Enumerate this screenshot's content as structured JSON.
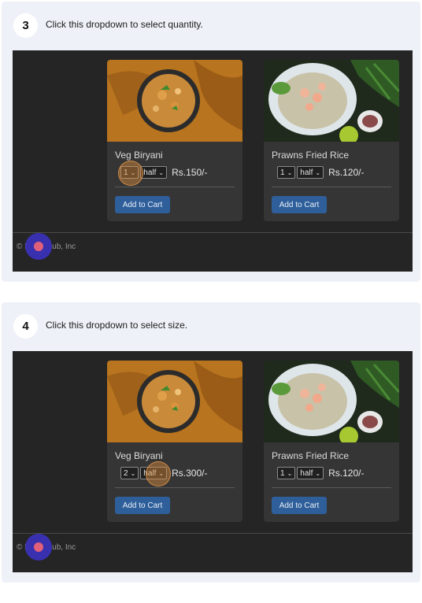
{
  "steps": [
    {
      "number": "3",
      "instruction": "Click this dropdown to select quantity.",
      "cards": [
        {
          "title": "Veg Biryani",
          "qty": "1",
          "size": "half",
          "price": "Rs.150/-",
          "button": "Add to Cart"
        },
        {
          "title": "Prawns Fried Rice",
          "qty": "1",
          "size": "half",
          "price": "Rs.120/-",
          "button": "Add to Cart"
        }
      ],
      "footer": "© FoodyHub, Inc"
    },
    {
      "number": "4",
      "instruction": "Click this dropdown to select size.",
      "cards": [
        {
          "title": "Veg Biryani",
          "qty": "2",
          "size": "half",
          "price": "Rs.300/-",
          "button": "Add to Cart"
        },
        {
          "title": "Prawns Fried Rice",
          "qty": "1",
          "size": "half",
          "price": "Rs.120/-",
          "button": "Add to Cart"
        }
      ],
      "footer": "© FoodyHub, Inc"
    }
  ],
  "colors": {
    "app_bg": "#252525",
    "card_bg": "#353535",
    "button": "#2f5f9a",
    "cursor": "#3930b0",
    "highlight": "#de8c3c"
  },
  "icons": {
    "dropdown": "chevron-down-icon",
    "cursor": "click-cursor-icon"
  }
}
